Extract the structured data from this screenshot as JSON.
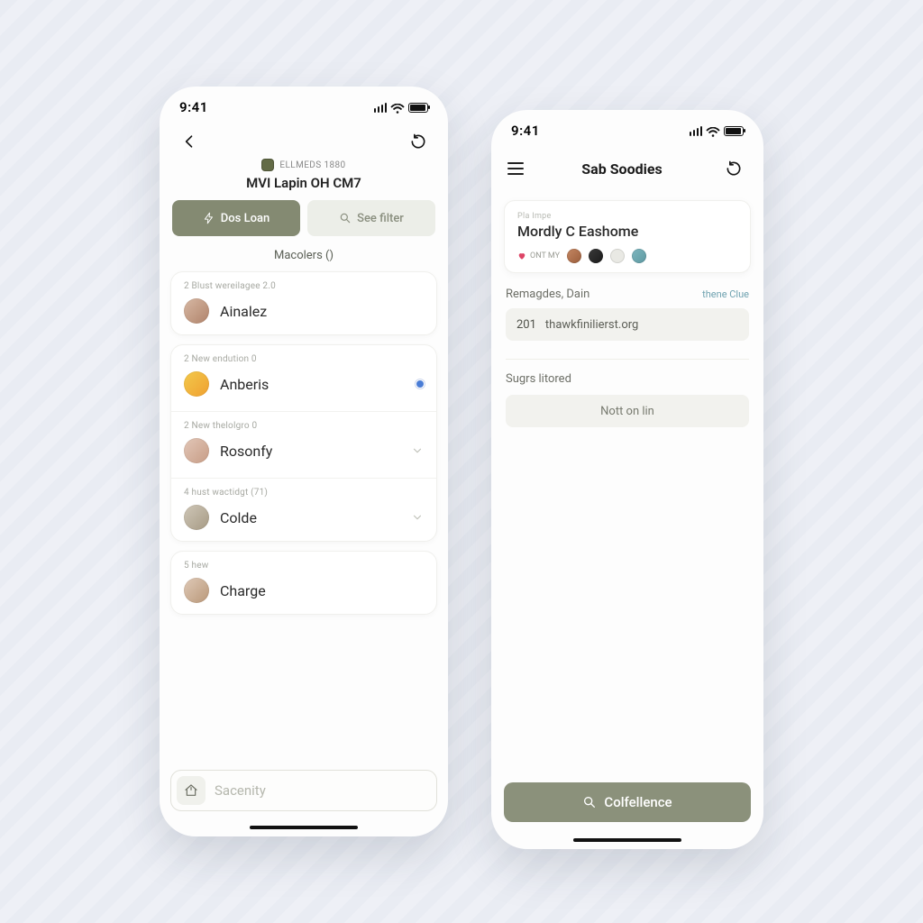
{
  "left": {
    "status": {
      "time": "9:41"
    },
    "header": {
      "tag": "ELLMEDS 1880",
      "title": "MVI Lapin OH CM7"
    },
    "buttons": {
      "primary": "Dos Loan",
      "secondary": "See filter"
    },
    "section_label": "Macolers ()",
    "cards": [
      {
        "head": "2 Blust wereilagee 2.0",
        "rows": [
          {
            "name": "Ainalez"
          }
        ]
      },
      {
        "head": "2 New endution 0",
        "rows": [
          {
            "name": "Anberis",
            "dot": true
          },
          {
            "sub": "2 New thelolgro 0",
            "name": "Rosonfy",
            "chev": true
          },
          {
            "sub": "4 hust wactidgt (71)",
            "name": "Colde",
            "chev": true
          }
        ]
      },
      {
        "head": "5 hew",
        "rows": [
          {
            "name": "Charge"
          }
        ]
      }
    ],
    "bottom_placeholder": "Sacenity"
  },
  "right": {
    "status": {
      "time": "9:41"
    },
    "title": "Sab Soodies",
    "card": {
      "eyebrow": "Pla Impe",
      "title": "Mordly C Eashome",
      "heart_label": "ONT MY"
    },
    "remages": {
      "label": "Remagdes, Dain",
      "link": "thene Clue",
      "num": "201",
      "url": "thawkfinilierst.org"
    },
    "sugrs_label": "Sugrs litored",
    "not_online": "Nott on lin",
    "cta": "Colfellence"
  }
}
